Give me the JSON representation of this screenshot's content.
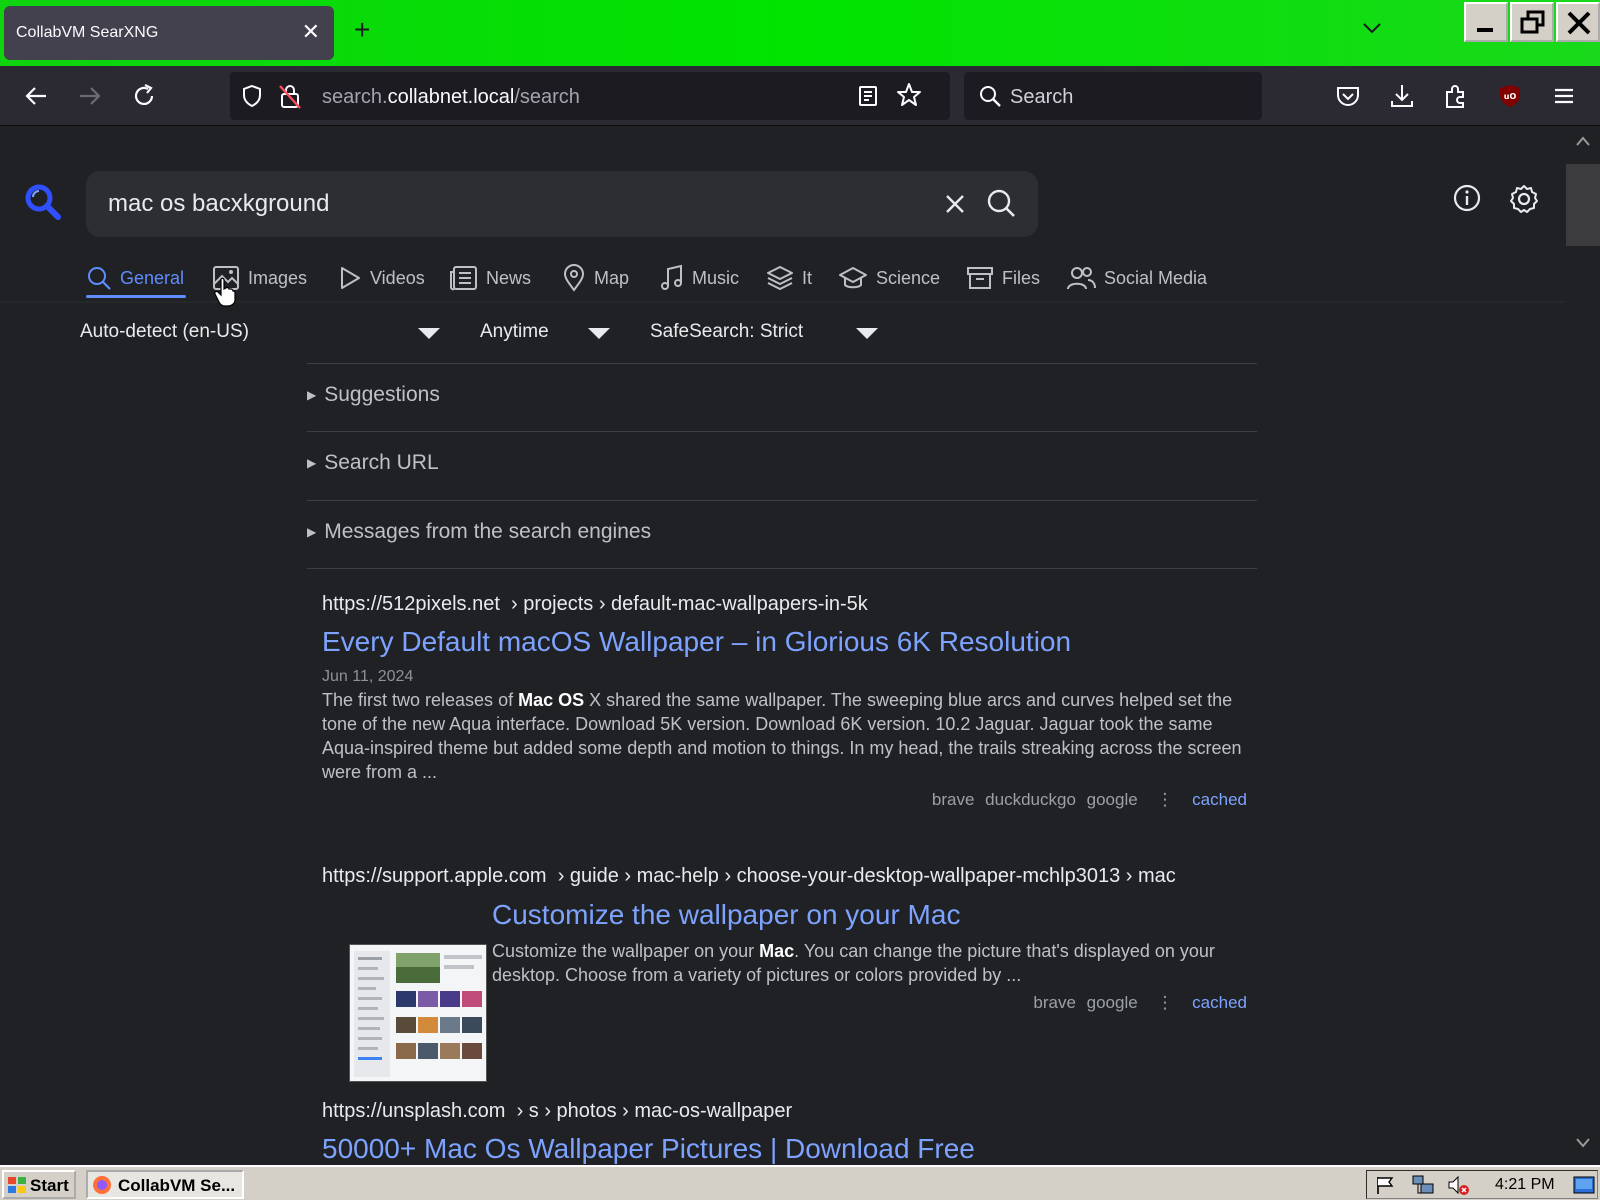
{
  "browser": {
    "tab_title": "CollabVM SearXNG",
    "url_host_prefix": "search.",
    "url_host_domain": "collabnet.local",
    "url_path": "/search",
    "searchbar_placeholder": "Search"
  },
  "search": {
    "query": "mac os bacxkground"
  },
  "categories": [
    {
      "label": "General",
      "icon": "search-icon",
      "active": true
    },
    {
      "label": "Images",
      "icon": "image-icon"
    },
    {
      "label": "Videos",
      "icon": "play-icon"
    },
    {
      "label": "News",
      "icon": "newspaper-icon"
    },
    {
      "label": "Map",
      "icon": "map-pin-icon"
    },
    {
      "label": "Music",
      "icon": "music-note-icon"
    },
    {
      "label": "It",
      "icon": "layers-icon"
    },
    {
      "label": "Science",
      "icon": "graduation-cap-icon"
    },
    {
      "label": "Files",
      "icon": "archive-icon"
    },
    {
      "label": "Social Media",
      "icon": "people-icon"
    }
  ],
  "filters": {
    "language": "Auto-detect (en-US)",
    "time_range": "Anytime",
    "safesearch": "SafeSearch: Strict"
  },
  "sections": {
    "suggestions": "Suggestions",
    "search_url": "Search URL",
    "engine_messages": "Messages from the search engines"
  },
  "results": [
    {
      "url": "https://512pixels.net",
      "breadcrumb": "› projects › default-mac-wallpapers-in-5k",
      "title": "Every Default macOS Wallpaper – in Glorious 6K Resolution",
      "date": "Jun 11, 2024",
      "content_pre": "The first two releases of ",
      "content_bold": "Mac OS",
      "content_post": " X shared the same wallpaper. The sweeping blue arcs and curves helped set the tone of the new Aqua interface. Download 5K version. Download 6K version. 10.2 Jaguar. Jaguar took the same Aqua-inspired theme but added some depth and motion to things. In my head, the trails streaking across the screen were from a ...",
      "engines": [
        "brave",
        "duckduckgo",
        "google"
      ],
      "cached": "cached"
    },
    {
      "url": "https://support.apple.com",
      "breadcrumb": "› guide › mac-help › choose-your-desktop-wallpaper-mchlp3013 › mac",
      "title": "Customize the wallpaper on your Mac",
      "content_pre": "Customize the wallpaper on your ",
      "content_bold": "Mac",
      "content_post": ". You can change the picture that's displayed on your desktop. Choose from a variety of pictures or colors provided by ...",
      "engines": [
        "brave",
        "google"
      ],
      "cached": "cached"
    },
    {
      "url": "https://unsplash.com",
      "breadcrumb": "› s › photos › mac-os-wallpaper",
      "title": "50000+ Mac Os Wallpaper Pictures | Download Free"
    }
  ],
  "taskbar": {
    "start_label": "Start",
    "task_label": "CollabVM Se...",
    "clock": "4:21 PM"
  },
  "colors": {
    "accent": "#5f8cff",
    "link": "#7da3ff",
    "titlebar": "#00e400",
    "page_bg": "#202124"
  }
}
